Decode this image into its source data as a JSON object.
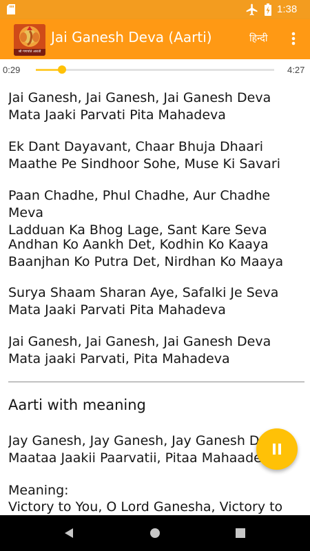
{
  "status_bar": {
    "time": "1:38",
    "icons": [
      "sd-card-icon",
      "airplane-icon",
      "battery-icon"
    ]
  },
  "app_bar": {
    "logo_caption": "श्री गणपति आरती",
    "title": "Jai Ganesh Deva (Aarti)",
    "language_button": "हिन्दी",
    "overflow_icon": "more-vert-icon",
    "color": "#ff9914"
  },
  "player": {
    "elapsed": "0:29",
    "duration": "4:27",
    "progress": 0.109,
    "accent": "#ffc107"
  },
  "stanzas": [
    "Jai Ganesh, Jai Ganesh, Jai Ganesh Deva\nMata Jaaki Parvati Pita Mahadeva",
    "Ek Dant Dayavant, Chaar Bhuja Dhaari\nMaathe Pe Sindhoor Sohe, Muse Ki Savari",
    "Paan Chadhe, Phul Chadhe, Aur Chadhe Meva\nLadduan Ka Bhog Lage, Sant Kare Seva",
    "Andhan Ko Aankh Det, Kodhin Ko Kaaya\nBaanjhan Ko Putra Det, Nirdhan Ko Maaya",
    "Surya Shaam Sharan Aye, Safalki Je Seva\nMata Jaaki Parvati Pita Mahadeva",
    "Jai Ganesh, Jai Ganesh, Jai Ganesh Deva\nMata jaaki Parvati, Pita Mahadeva"
  ],
  "meaning_section": {
    "heading": "Aarti with meaning",
    "verse": "Jay Ganesh, Jay Ganesh, Jay Ganesh Deva\nMaataa Jaakii Paarvatii, Pitaa Mahaadeva",
    "meaning_label": "Meaning:",
    "meaning_text": "Victory to You, O Lord Ganesha, Victory to"
  },
  "fab": {
    "icon": "pause-icon"
  },
  "nav_bar": {
    "icons": [
      "back-icon",
      "home-icon",
      "recents-icon"
    ]
  }
}
